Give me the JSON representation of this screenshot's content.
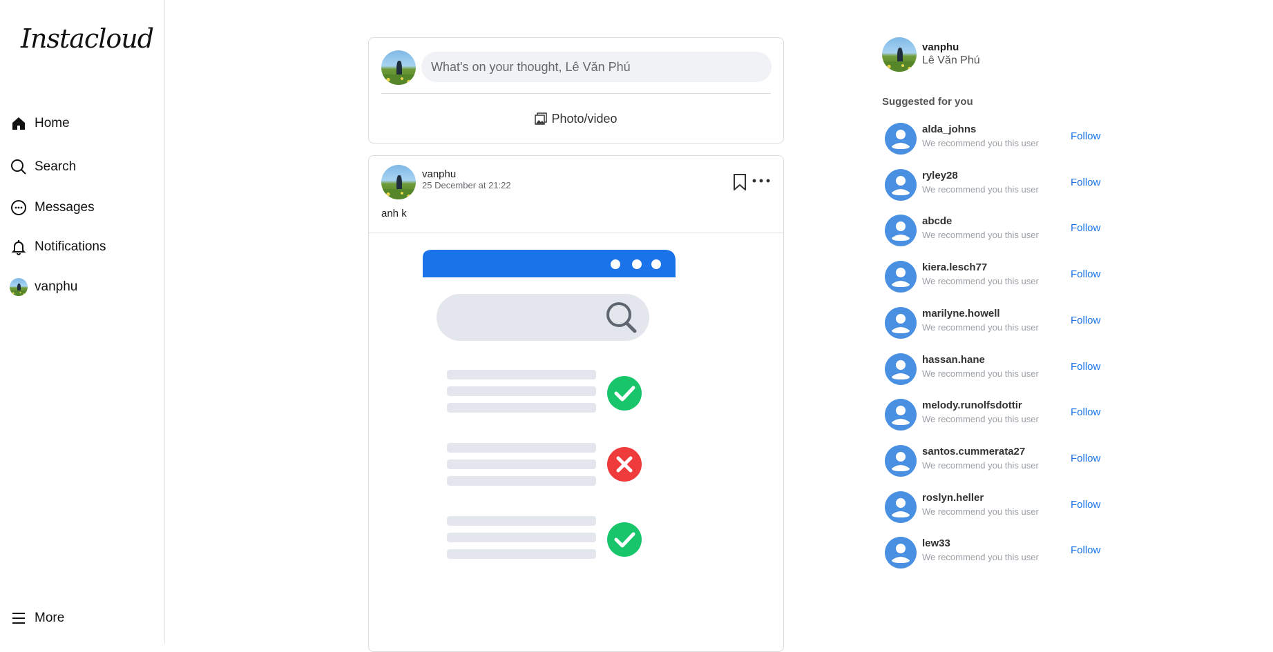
{
  "app": {
    "name": "Instacloud"
  },
  "sidebar": {
    "items": [
      {
        "label": "Home",
        "icon": "home-icon"
      },
      {
        "label": "Search",
        "icon": "search-icon"
      },
      {
        "label": "Messages",
        "icon": "message-icon"
      },
      {
        "label": "Notifications",
        "icon": "bell-icon"
      },
      {
        "label": "vanphu",
        "icon": "avatar"
      }
    ],
    "more_label": "More"
  },
  "composer": {
    "placeholder": "What's on your thought, Lê Văn Phú",
    "photo_video_label": "Photo/video"
  },
  "post": {
    "username": "vanphu",
    "time": "25 December at 21:22",
    "caption": "anh k"
  },
  "current_user": {
    "username": "vanphu",
    "full_name": "Lê Văn Phú"
  },
  "suggestions": {
    "title": "Suggested for you",
    "follow_label": "Follow",
    "reason": "We recommend you this user",
    "users": [
      "alda_johns",
      "ryley28",
      "abcde",
      "kiera.lesch77",
      "marilyne.howell",
      "hassan.hane",
      "melody.runolfsdottir",
      "santos.cummerata27",
      "roslyn.heller",
      "lew33"
    ]
  },
  "colors": {
    "accent": "#1a73e8",
    "banner": "#1a73e8",
    "check": "#19c56b",
    "cross": "#ef3b3b"
  }
}
